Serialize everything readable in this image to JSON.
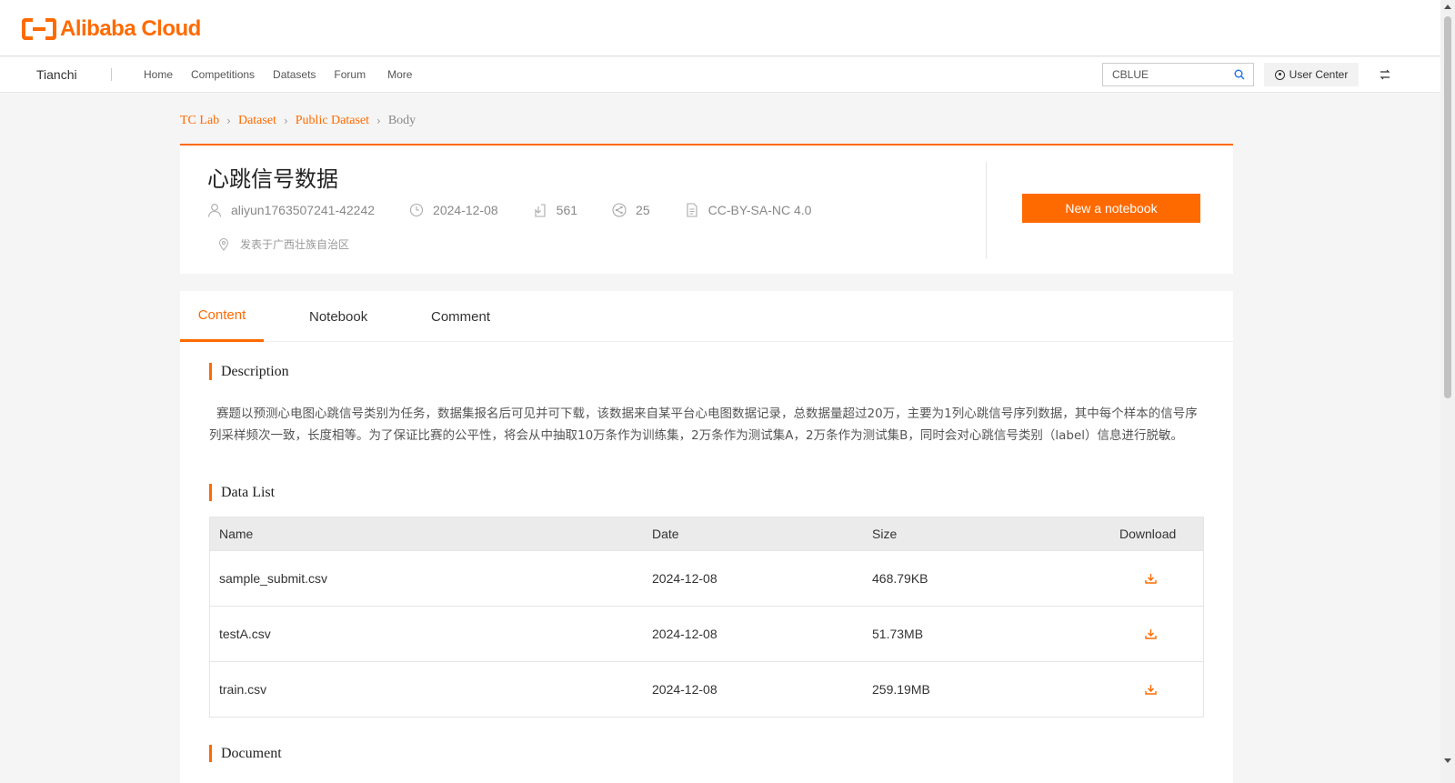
{
  "brand": {
    "logo_text": "Alibaba Cloud",
    "accent": "#ff6a00"
  },
  "nav": {
    "brand": "Tianchi",
    "links": [
      "Home",
      "Competitions",
      "Datasets",
      "Forum",
      "More"
    ],
    "search_value": "CBLUE",
    "user_center": "User Center"
  },
  "breadcrumb": [
    "TC Lab",
    "Dataset",
    "Public Dataset",
    "Body"
  ],
  "dataset": {
    "title": "心跳信号数据",
    "author": "aliyun1763507241-42242",
    "date": "2024-12-08",
    "downloads": "561",
    "shares": "25",
    "license": "CC-BY-SA-NC 4.0",
    "location": "发表于广西壮族自治区",
    "new_notebook": "New a notebook"
  },
  "tabs": [
    "Content",
    "Notebook",
    "Comment"
  ],
  "sections": {
    "description": "Description",
    "description_text": "赛题以预测心电图心跳信号类别为任务，数据集报名后可见并可下载，该数据来自某平台心电图数据记录，总数据量超过20万，主要为1列心跳信号序列数据，其中每个样本的信号序列采样频次一致，长度相等。为了保证比赛的公平性，将会从中抽取10万条作为训练集，2万条作为测试集A，2万条作为测试集B，同时会对心跳信号类别（label）信息进行脱敏。",
    "data_list": "Data List",
    "document": "Document"
  },
  "table": {
    "headers": [
      "Name",
      "Date",
      "Size",
      "Download"
    ],
    "rows": [
      {
        "name": "sample_submit.csv",
        "date": "2024-12-08",
        "size": "468.79KB",
        "icon": "download-icon"
      },
      {
        "name": "testA.csv",
        "date": "2024-12-08",
        "size": "51.73MB",
        "icon": "download-icon"
      },
      {
        "name": "train.csv",
        "date": "2024-12-08",
        "size": "259.19MB",
        "icon": "download-icon"
      }
    ]
  }
}
